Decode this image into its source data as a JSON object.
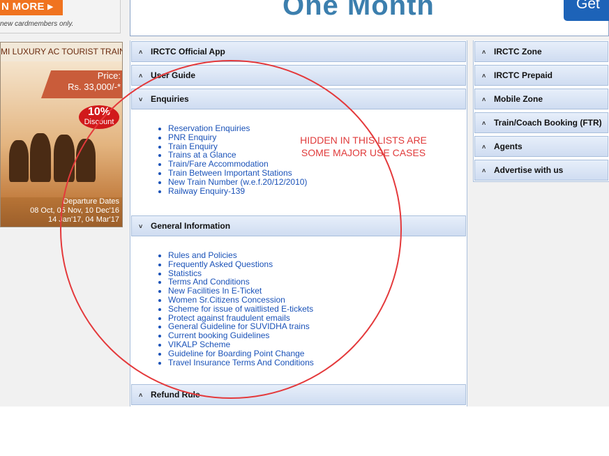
{
  "ad_top": {
    "button_label": "N MORE ▸",
    "note": "new cardmembers only."
  },
  "banner": {
    "headline": "One Month",
    "button_label": "Get"
  },
  "train_ad": {
    "title": "MI LUXURY AC TOURIST TRAIN",
    "price_label": "Price:",
    "price_value": "Rs. 33,000/-*",
    "discount_value": "10%",
    "discount_label": "Discount",
    "departure_title": "Departure Dates",
    "departure_line1": "08 Oct, 05 Nov, 10 Dec'16",
    "departure_line2": "14 Jan'17, 04 Mar'17"
  },
  "center": {
    "sections": [
      {
        "label": "IRCTC Official App"
      },
      {
        "label": "User Guide"
      },
      {
        "label": "Enquiries"
      },
      {
        "label": "General Information"
      },
      {
        "label": "Refund Rule"
      }
    ],
    "enquiries": [
      "Reservation Enquiries",
      "PNR Enquiry",
      "Train Enquiry",
      "Trains at a Glance",
      "Train/Fare Accommodation",
      "Train Between Important Stations",
      "New Train Number (w.e.f.20/12/2010)",
      "Railway Enquiry-139"
    ],
    "general_info": [
      "Rules and Policies",
      "Frequently Asked Questions",
      "Statistics",
      "Terms And Conditions",
      "New Facilities In E-Ticket",
      "Women Sr.Citizens Concession",
      "Scheme for issue of waitlisted E-tickets",
      "Protect against fraudulent emails",
      "General Guideline for SUVIDHA trains",
      "Current booking Guidelines",
      "VIKALP Scheme",
      "Guideline for Boarding Point Change",
      "Travel Insurance Terms And Conditions"
    ]
  },
  "right": {
    "sections": [
      {
        "label": "IRCTC Zone"
      },
      {
        "label": "IRCTC Prepaid"
      },
      {
        "label": "Mobile Zone"
      },
      {
        "label": "Train/Coach Booking (FTR)"
      },
      {
        "label": "Agents"
      },
      {
        "label": "Advertise with us"
      }
    ]
  },
  "annotation": {
    "line1": "HIDDEN IN THIS LISTS ARE",
    "line2": "SOME MAJOR USE CASES"
  },
  "icons": {
    "expanded": "chevron-down-icon",
    "collapsed": "chevron-up-icon"
  },
  "colors": {
    "link": "#1a52b8",
    "annotation": "#e03b3b",
    "header_top": "#e7effa",
    "header_bottom": "#cfdcf1"
  }
}
